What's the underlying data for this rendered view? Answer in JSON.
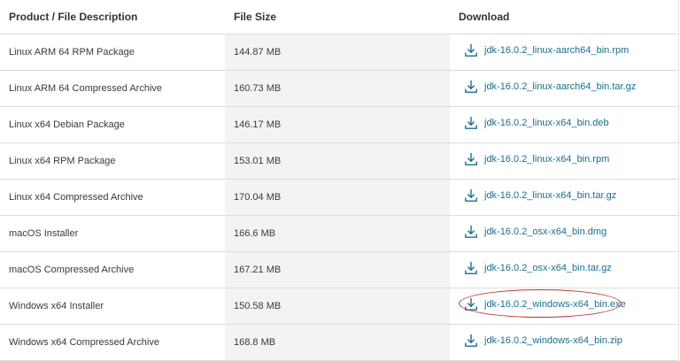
{
  "table": {
    "headers": {
      "description": "Product / File Description",
      "size": "File Size",
      "download": "Download"
    },
    "rows": [
      {
        "description": "Linux ARM 64 RPM Package",
        "size": "144.87 MB",
        "file": "jdk-16.0.2_linux-aarch64_bin.rpm"
      },
      {
        "description": "Linux ARM 64 Compressed Archive",
        "size": "160.73 MB",
        "file": "jdk-16.0.2_linux-aarch64_bin.tar.gz"
      },
      {
        "description": "Linux x64 Debian Package",
        "size": "146.17 MB",
        "file": "jdk-16.0.2_linux-x64_bin.deb"
      },
      {
        "description": "Linux x64 RPM Package",
        "size": "153.01 MB",
        "file": "jdk-16.0.2_linux-x64_bin.rpm"
      },
      {
        "description": "Linux x64 Compressed Archive",
        "size": "170.04 MB",
        "file": "jdk-16.0.2_linux-x64_bin.tar.gz"
      },
      {
        "description": "macOS Installer",
        "size": "166.6 MB",
        "file": "jdk-16.0.2_osx-x64_bin.dmg"
      },
      {
        "description": "macOS Compressed Archive",
        "size": "167.21 MB",
        "file": "jdk-16.0.2_osx-x64_bin.tar.gz"
      },
      {
        "description": "Windows x64 Installer",
        "size": "150.58 MB",
        "file": "jdk-16.0.2_windows-x64_bin.exe"
      },
      {
        "description": "Windows x64 Compressed Archive",
        "size": "168.8 MB",
        "file": "jdk-16.0.2_windows-x64_bin.zip"
      }
    ]
  },
  "icons": {
    "download": "download-icon",
    "highlight": "highlight-ring"
  },
  "colors": {
    "link": "#1a6e8e",
    "highlight": "#c0312b",
    "size_column_bg": "#f3f3f3"
  }
}
